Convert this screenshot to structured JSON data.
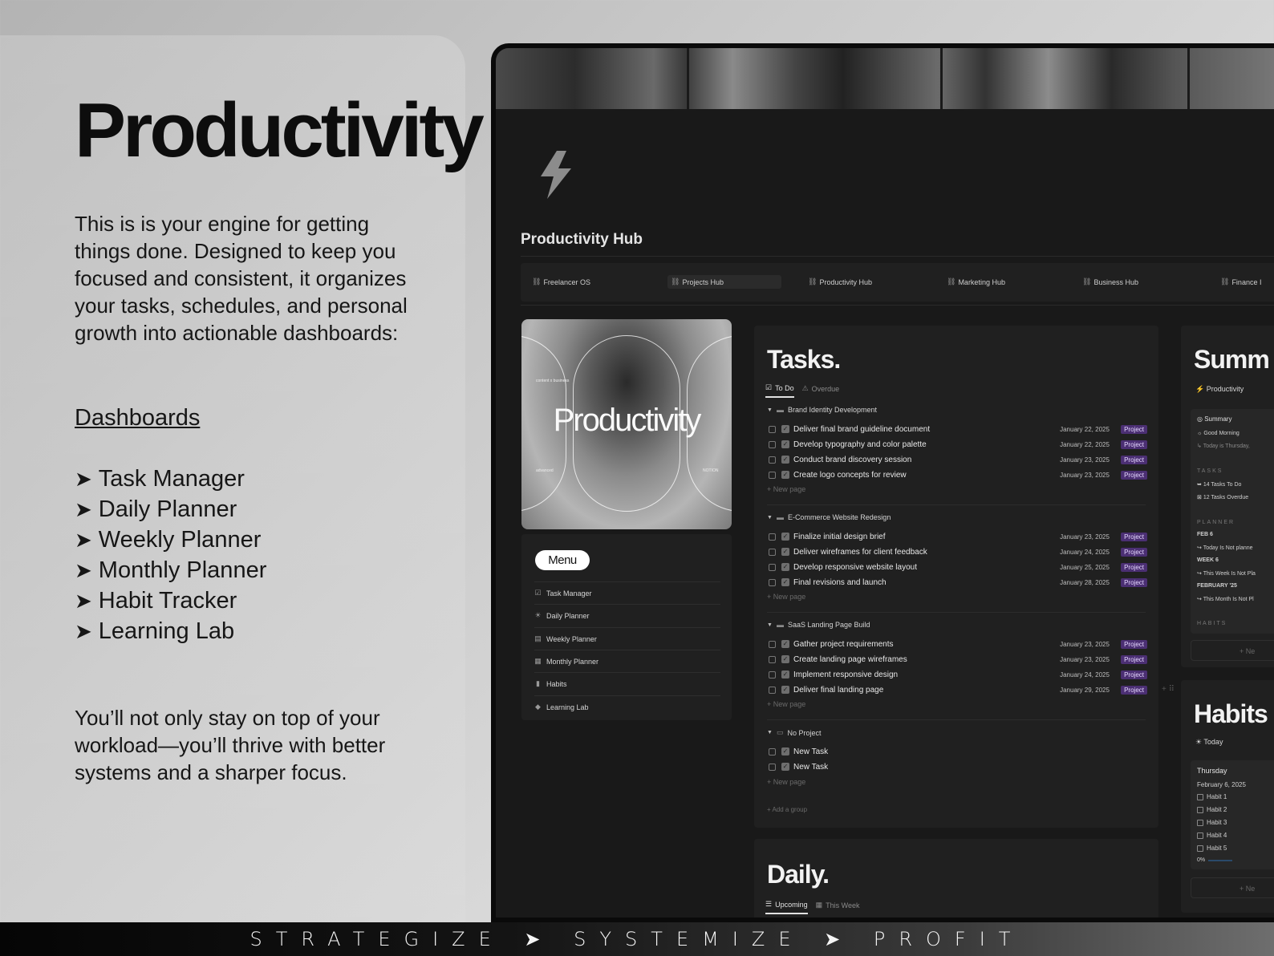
{
  "hero": {
    "title": "Productivity",
    "intro": "This is is your engine for getting things done. Designed to keep you focused and consistent, it organizes your tasks, schedules, and personal growth into actionable dashboards:",
    "dashboards_heading": "Dashboards",
    "arrow": "➤",
    "dashboards": [
      "Task Manager",
      "Daily Planner",
      "Weekly Planner",
      "Monthly Planner",
      "Habit Tracker",
      "Learning Lab"
    ],
    "outro": "You’ll not only stay on top of your workload—you’ll thrive with better systems and a sharper focus."
  },
  "app": {
    "page_title": "Productivity Hub",
    "nav": [
      {
        "label": "Freelancer OS",
        "active": false
      },
      {
        "label": "Projects Hub",
        "active": true
      },
      {
        "label": "Productivity Hub",
        "active": false
      },
      {
        "label": "Marketing Hub",
        "active": false
      },
      {
        "label": "Business Hub",
        "active": false
      },
      {
        "label": "Finance I",
        "active": false
      }
    ],
    "art": {
      "word": "Productivity",
      "small_top": "content x business",
      "small_left": "advanced",
      "small_right": "NOTION"
    },
    "menu": {
      "pill": "Menu",
      "items": [
        {
          "label": "Task Manager",
          "icon": "checkbox-icon"
        },
        {
          "label": "Daily Planner",
          "icon": "sun-icon"
        },
        {
          "label": "Weekly Planner",
          "icon": "book-icon"
        },
        {
          "label": "Monthly Planner",
          "icon": "calendar-icon"
        },
        {
          "label": "Habits",
          "icon": "bar-chart-icon"
        },
        {
          "label": "Learning Lab",
          "icon": "graduation-cap-icon"
        }
      ]
    },
    "tasks": {
      "title": "Tasks.",
      "tabs": [
        "To Do",
        "Overdue"
      ],
      "new_page": "New page",
      "add_group": "Add a group",
      "groups": [
        {
          "name": "Brand Identity Development",
          "items": [
            {
              "name": "Deliver final brand guideline document",
              "date": "January 22, 2025",
              "tag": "Project"
            },
            {
              "name": "Develop typography and color palette",
              "date": "January 22, 2025",
              "tag": "Project"
            },
            {
              "name": "Conduct brand discovery session",
              "date": "January 23, 2025",
              "tag": "Project"
            },
            {
              "name": "Create logo concepts for review",
              "date": "January 23, 2025",
              "tag": "Project"
            }
          ]
        },
        {
          "name": "E-Commerce Website Redesign",
          "items": [
            {
              "name": "Finalize initial design brief",
              "date": "January 23, 2025",
              "tag": "Project"
            },
            {
              "name": "Deliver wireframes for client feedback",
              "date": "January 24, 2025",
              "tag": "Project"
            },
            {
              "name": "Develop responsive website layout",
              "date": "January 25, 2025",
              "tag": "Project"
            },
            {
              "name": "Final revisions and launch",
              "date": "January 28, 2025",
              "tag": "Project"
            }
          ]
        },
        {
          "name": "SaaS Landing Page Build",
          "items": [
            {
              "name": "Gather project requirements",
              "date": "January 23, 2025",
              "tag": "Project"
            },
            {
              "name": "Create landing page wireframes",
              "date": "January 23, 2025",
              "tag": "Project"
            },
            {
              "name": "Implement responsive design",
              "date": "January 24, 2025",
              "tag": "Project"
            },
            {
              "name": "Deliver final landing page",
              "date": "January 29, 2025",
              "tag": "Project"
            }
          ]
        },
        {
          "name": "No Project",
          "items": [
            {
              "name": "New Task",
              "date": "",
              "tag": ""
            },
            {
              "name": "New Task",
              "date": "",
              "tag": ""
            }
          ]
        }
      ]
    },
    "daily": {
      "title": "Daily.",
      "tabs": [
        "Upcoming",
        "This Week"
      ]
    },
    "summary": {
      "title": "Summ",
      "subtitle": "Productivity",
      "inner_title": "Summary",
      "greeting": "Good Morning",
      "today_line": "Today is Thursday,",
      "tasks_label": "TASKS",
      "tasks_todo": "14 Tasks To Do",
      "tasks_overdue": "12 Tasks Overdue",
      "planner_label": "PLANNER",
      "feb6": "FEB 6",
      "today_not_planned": "Today Is Not planne",
      "week6": "WEEK 6",
      "week_not_planned": "This Week Is Not Pla",
      "feb25": "FEBRUARY '25",
      "month_not_planned": "This Month Is Not Pl",
      "habits_label": "HABITS",
      "new": "Ne"
    },
    "habits": {
      "title": "Habits",
      "subtitle": "Today",
      "day": "Thursday",
      "date": "February 6, 2025",
      "items": [
        "Habit 1",
        "Habit 2",
        "Habit 3",
        "Habit 4",
        "Habit 5"
      ],
      "progress": "0%",
      "progress_value": 0,
      "new": "Ne"
    }
  },
  "footer": {
    "tagline": "STRATEGIZE ➤ SYSTEMIZE ➤ PROFIT"
  },
  "colors": {
    "badge_bg": "#4b2f73",
    "badge_text": "#e6d8ff",
    "app_bg": "#191919",
    "card_bg": "#202020"
  }
}
